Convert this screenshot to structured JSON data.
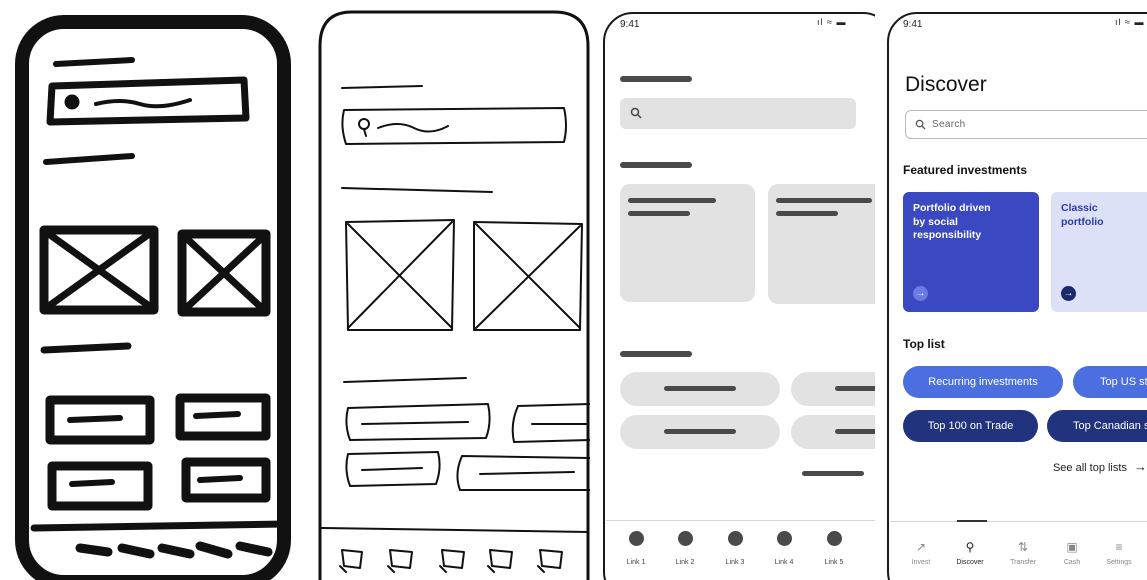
{
  "wireframe": {
    "status_time": "9:41",
    "status_icons": "signal-wifi-battery-icons",
    "status_glyphs": "ıl ≈ ▬",
    "nav_links": [
      "Link 1",
      "Link 2",
      "Link 3",
      "Link 4",
      "Link 5"
    ]
  },
  "app": {
    "status_time": "9:41",
    "status_glyphs": "ıl ≈ ▬",
    "page_title": "Discover",
    "search": {
      "placeholder": "Search"
    },
    "featured": {
      "heading": "Featured investments",
      "cards": [
        {
          "label": "Portfolio driven by social responsibility",
          "color": "#3a49c1",
          "text_color": "#ffffff"
        },
        {
          "label": "Classic portfolio",
          "color": "#dde1f7",
          "text_color": "#2a3aa8"
        }
      ]
    },
    "top_list": {
      "heading": "Top list",
      "pills": [
        {
          "label": "Recurring investments",
          "color": "#4b6fe0"
        },
        {
          "label": "Top US st",
          "color": "#4b6fe0"
        },
        {
          "label": "Top 100 on Trade",
          "color": "#22337e"
        },
        {
          "label": "Top Canadian s",
          "color": "#22337e"
        }
      ],
      "see_all": "See all top lists",
      "see_all_arrow": "→"
    },
    "tabs": [
      {
        "label": "Invest",
        "icon": "trend-icon",
        "glyph": "↗",
        "active": false
      },
      {
        "label": "Discover",
        "icon": "search-icon",
        "glyph": "⚲",
        "active": true
      },
      {
        "label": "Transfer",
        "icon": "transfer-icon",
        "glyph": "⇅",
        "active": false
      },
      {
        "label": "Cash",
        "icon": "cash-icon",
        "glyph": "▣",
        "active": false
      },
      {
        "label": "Settings",
        "icon": "menu-icon",
        "glyph": "≡",
        "active": false
      }
    ]
  }
}
